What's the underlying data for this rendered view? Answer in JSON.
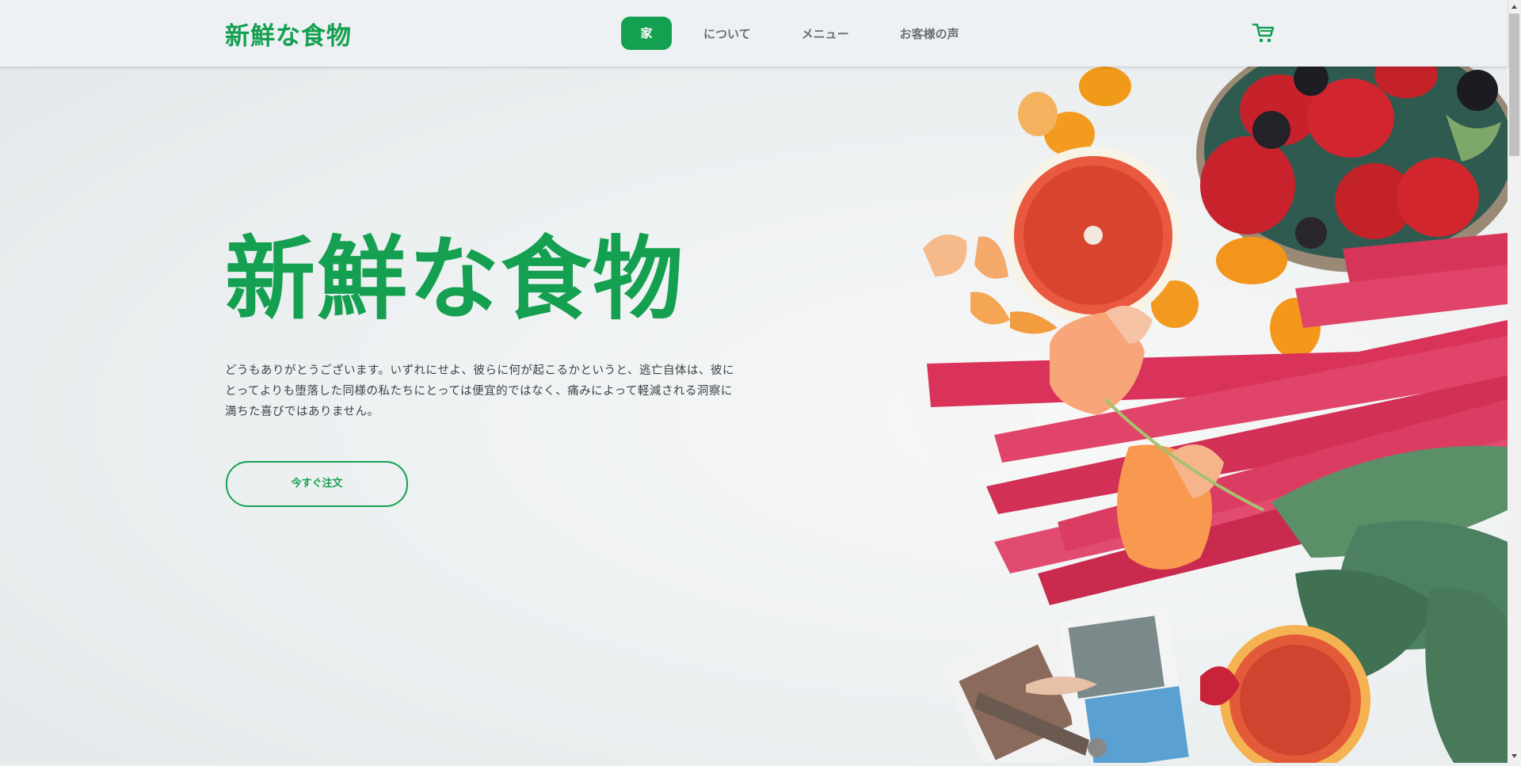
{
  "header": {
    "logo": "新鮮な食物",
    "nav": [
      "家",
      "について",
      "メニュー",
      "お客様の声"
    ],
    "cart_icon": "shopping-cart-icon"
  },
  "hero": {
    "title": "新鮮な食物",
    "description": "どうもありがとうございます。いずれにせよ、彼らに何が起こるかというと、逃亡自体は、彼にとってよりも堕落した同様の私たちにとっては便宜的ではなく、痛みによって軽減される洞察に満ちた喜びではありません。",
    "button": "今すぐ注文"
  },
  "colors": {
    "brand": "#14a050",
    "header_bg": "#eef1f4",
    "text": "#3c4246"
  }
}
